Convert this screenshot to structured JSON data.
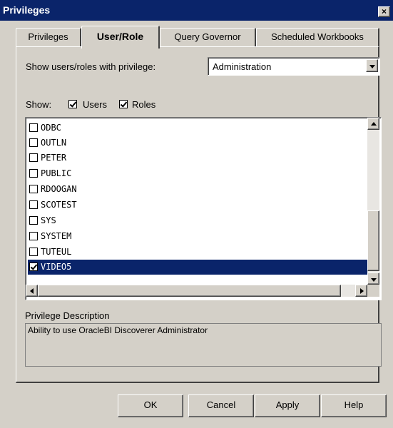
{
  "window": {
    "title": "Privileges"
  },
  "tabs": [
    {
      "label": "Privileges",
      "active": false
    },
    {
      "label": "User/Role",
      "active": true
    },
    {
      "label": "Query Governor",
      "active": false
    },
    {
      "label": "Scheduled Workbooks",
      "active": false
    }
  ],
  "privilege_filter": {
    "label": "Show users/roles with privilege:",
    "selected": "Administration"
  },
  "show": {
    "label": "Show:",
    "users_label": "Users",
    "users_checked": true,
    "roles_label": "Roles",
    "roles_checked": true
  },
  "list": {
    "items": [
      {
        "name": "ODBC",
        "checked": false,
        "selected": false
      },
      {
        "name": "OUTLN",
        "checked": false,
        "selected": false
      },
      {
        "name": "PETER",
        "checked": false,
        "selected": false
      },
      {
        "name": "PUBLIC",
        "checked": false,
        "selected": false
      },
      {
        "name": "RDOOGAN",
        "checked": false,
        "selected": false
      },
      {
        "name": "SCOTEST",
        "checked": false,
        "selected": false
      },
      {
        "name": "SYS",
        "checked": false,
        "selected": false
      },
      {
        "name": "SYSTEM",
        "checked": false,
        "selected": false
      },
      {
        "name": "TUTEUL",
        "checked": false,
        "selected": false
      },
      {
        "name": "VIDEO5",
        "checked": true,
        "selected": true
      }
    ]
  },
  "description": {
    "label": "Privilege Description",
    "text": "Ability to use OracleBI Discoverer Administrator"
  },
  "buttons": {
    "ok": "OK",
    "cancel": "Cancel",
    "apply": "Apply",
    "help": "Help"
  },
  "colors": {
    "face": "#d4d0c8",
    "titlebar": "#0a246a",
    "selection": "#0a246a"
  }
}
